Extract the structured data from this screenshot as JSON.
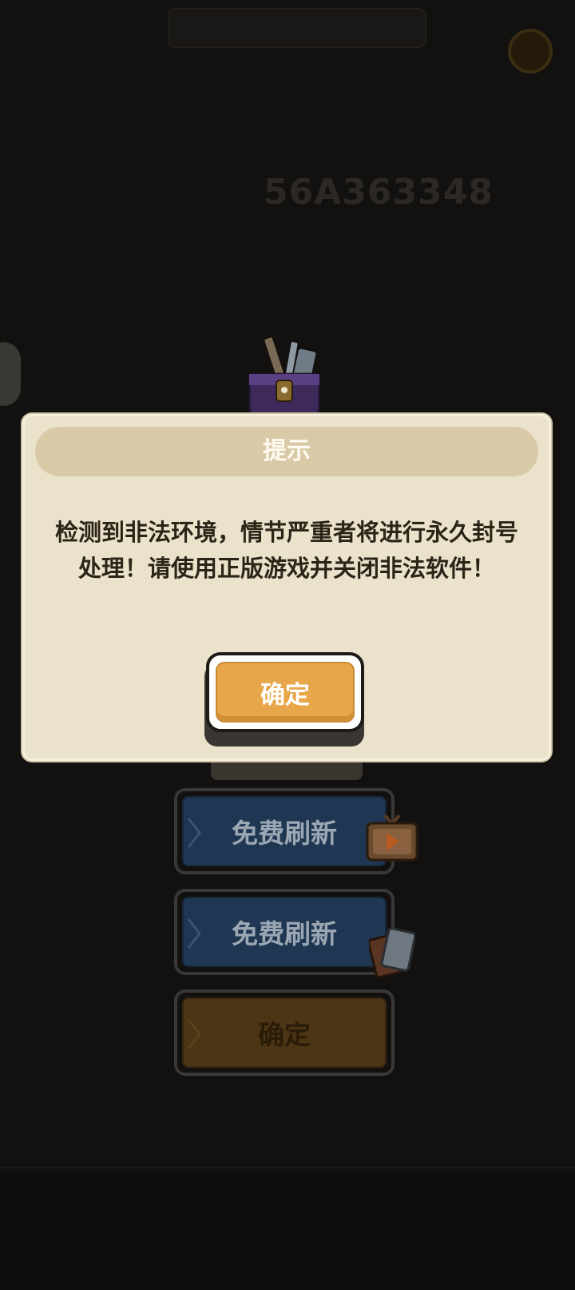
{
  "background": {
    "score_text": "56A363348"
  },
  "dialog": {
    "title": "提示",
    "message": "检测到非法环境，情节严重者将进行永久封号处理！请使用正版游戏并关闭非法软件！",
    "confirm_label": "确定"
  },
  "buttons": {
    "free_refresh_video_label": "免费刷新",
    "free_refresh_card_label": "免费刷新",
    "confirm_label": "确定"
  },
  "colors": {
    "dialog_bg": "#ebe2cc",
    "dialog_header": "#d8c9a7",
    "confirm_orange": "#e8a64a",
    "blue_button": "#1f3752",
    "brown_button": "#4b3514"
  },
  "icons": [
    "treasure-chest-icon",
    "video-tv-icon",
    "card-icon",
    "coin-icon"
  ]
}
